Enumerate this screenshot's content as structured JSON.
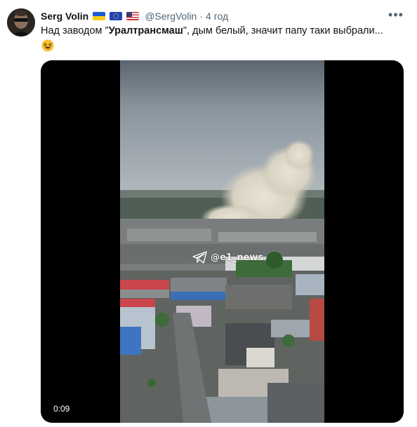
{
  "author": {
    "display_name": "Serg Volin",
    "flags": [
      "ua-flag",
      "eu-flag",
      "us-flag"
    ],
    "handle": "@SergVolin",
    "separator": "·",
    "time": "4 год"
  },
  "tweet": {
    "text_before": "Над заводом \"",
    "text_bold": "Уралтрансмаш",
    "text_after": "\", дым белый, значит папу таки выбрали...",
    "emoji": "laughing-face-emoji"
  },
  "media": {
    "watermark": "@e1_news",
    "duration": "0:09"
  },
  "menu_icon": "more-horizontal-icon"
}
